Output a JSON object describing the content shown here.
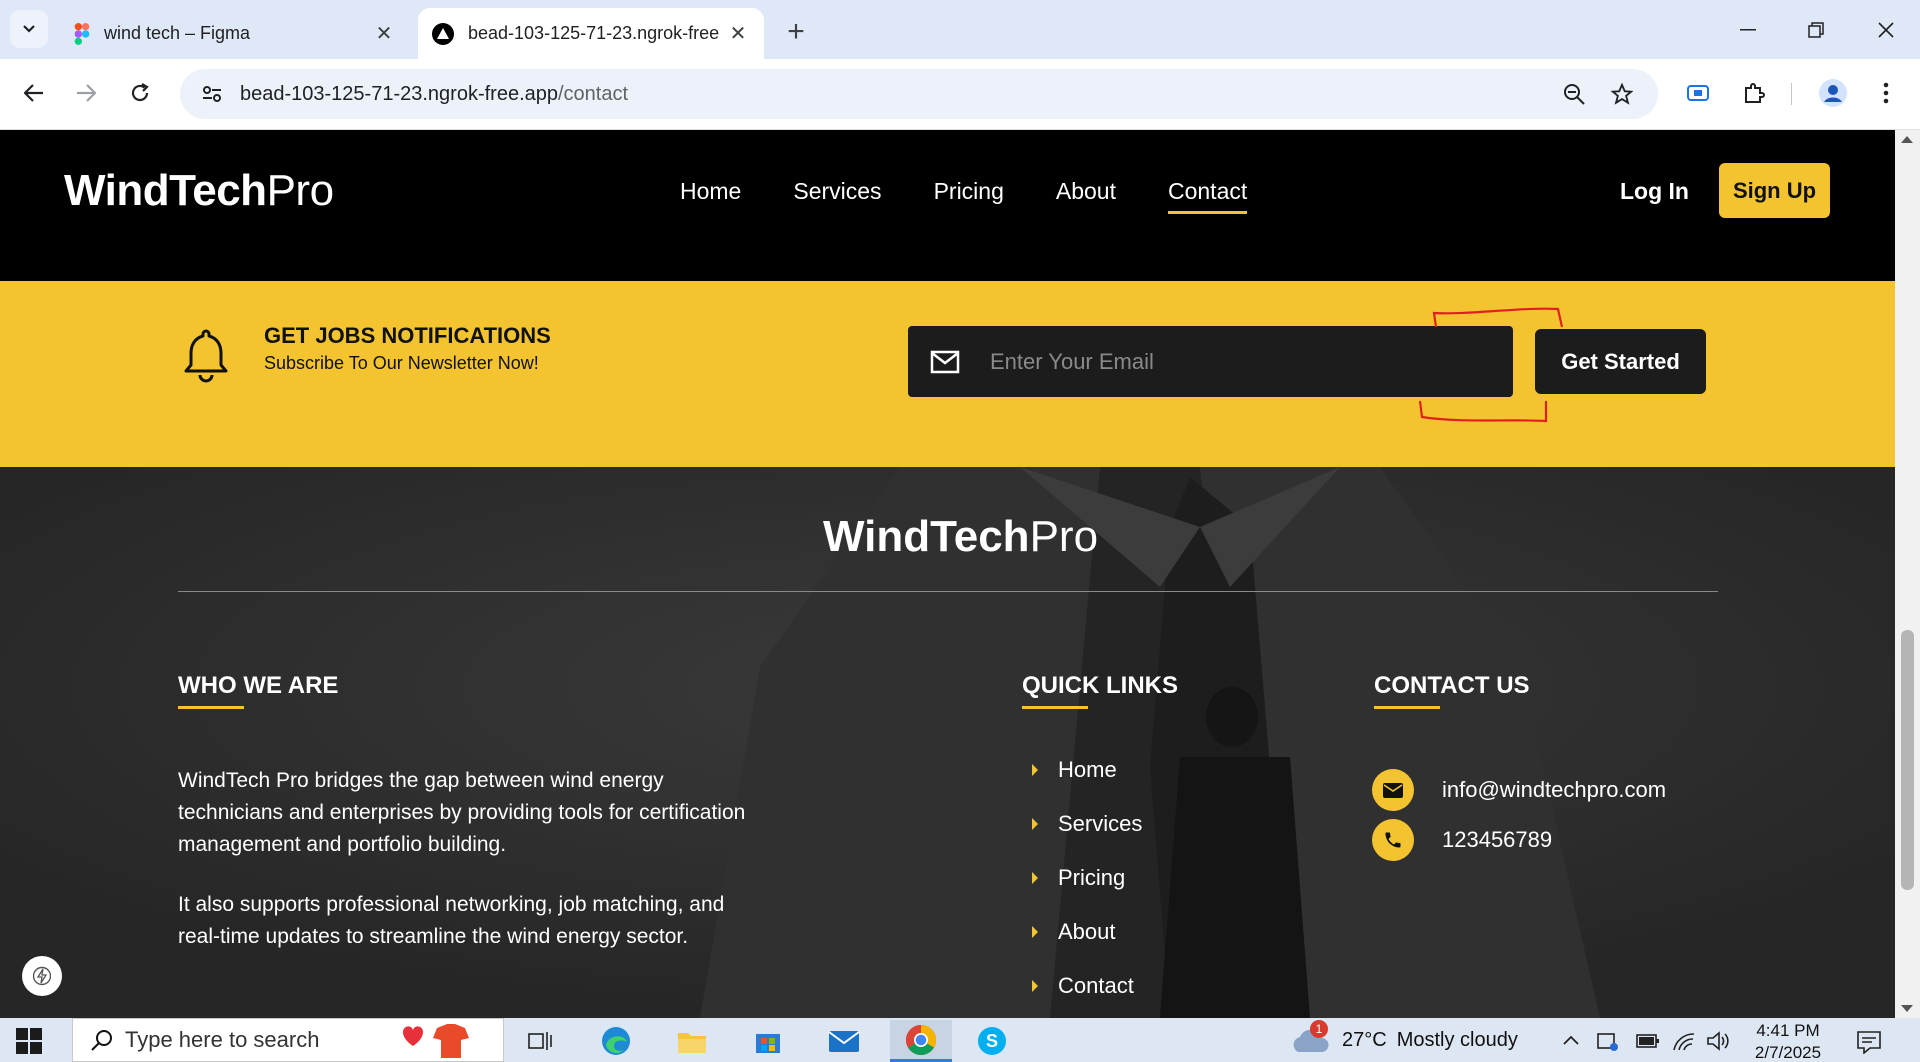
{
  "browser": {
    "tabs": [
      {
        "title": "wind tech – Figma",
        "active": false
      },
      {
        "title": "bead-103-125-71-23.ngrok-free",
        "active": true
      }
    ],
    "url_host": "bead-103-125-71-23.ngrok-free.app",
    "url_path": "/contact"
  },
  "site": {
    "logo_bold": "WindTech",
    "logo_light": "Pro",
    "nav": [
      "Home",
      "Services",
      "Pricing",
      "About",
      "Contact"
    ],
    "current_nav": "Contact",
    "login_label": "Log In",
    "signup_label": "Sign Up"
  },
  "newsletter": {
    "title": "GET JOBS NOTIFICATIONS",
    "subtitle": "Subscribe To Our Newsletter Now!",
    "email_placeholder": "Enter Your Email",
    "cta_label": "Get Started"
  },
  "footer": {
    "logo_bold": "WindTech",
    "logo_light": "Pro",
    "who_title": "WHO WE ARE",
    "who_p1": "WindTech Pro bridges the gap between wind energy technicians and enterprises by providing tools for certification management and portfolio building.",
    "who_p2": "It also supports professional networking, job matching, and real-time updates to streamline the wind energy sector.",
    "links_title": "QUICK LINKS",
    "links": [
      "Home",
      "Services",
      "Pricing",
      "About",
      "Contact"
    ],
    "contact_title": "CONTACT US",
    "email": "info@windtechpro.com",
    "phone": "123456789"
  },
  "taskbar": {
    "search_placeholder": "Type here to search",
    "weather_temp": "27°C",
    "weather_desc": "Mostly cloudy",
    "weather_badge": "1",
    "time": "4:41 PM",
    "date": "2/7/2025"
  },
  "colors": {
    "accent": "#f4c430",
    "header_bg": "#000000",
    "footer_bg": "#2e2e2e",
    "annotation": "#e02020"
  }
}
